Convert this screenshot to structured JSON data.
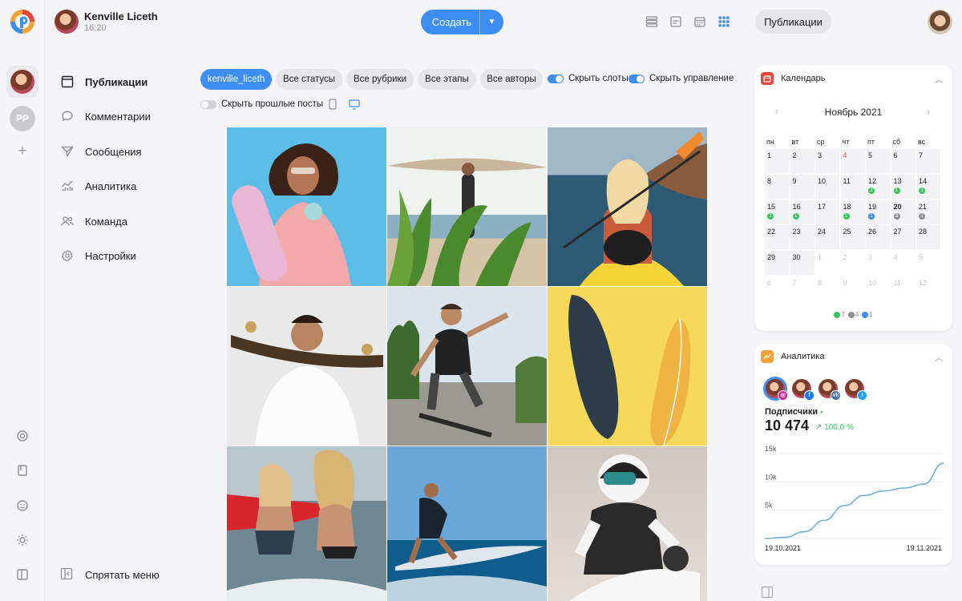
{
  "header": {
    "user_name": "Kenville Liceth",
    "time": "16:20",
    "create_label": "Создать",
    "publications_label": "Публикации",
    "view_icons": [
      "list-view-icon",
      "feed-view-icon",
      "calendar-view-icon",
      "grid-view-icon"
    ]
  },
  "rail": {
    "account_initials": "PP",
    "add_label": "+",
    "bottom_icons": [
      "target-icon",
      "book-icon",
      "smile-icon",
      "sun-icon",
      "panel-icon"
    ]
  },
  "nav": {
    "items": [
      {
        "label": "Публикации",
        "icon": "calendar-page-icon"
      },
      {
        "label": "Комментарии",
        "icon": "chat-bubble-icon"
      },
      {
        "label": "Сообщения",
        "icon": "send-icon"
      },
      {
        "label": "Аналитика",
        "icon": "analytics-icon"
      },
      {
        "label": "Команда",
        "icon": "team-icon"
      },
      {
        "label": "Настройки",
        "icon": "gear-icon"
      }
    ],
    "hide_menu": "Спрятать меню"
  },
  "filters": {
    "chips": [
      "kenville_liceth",
      "Все статусы",
      "Все рубрики",
      "Все этапы",
      "Все авторы"
    ],
    "hide_slots": "Скрыть слоты",
    "hide_control": "Скрыть управление",
    "hide_past": "Скрыть прошлые посты"
  },
  "posts": [
    {
      "subject": "woman-with-skateboard",
      "bg": "#5cbde6"
    },
    {
      "subject": "surfer-with-board",
      "bg": "#cfd8c8"
    },
    {
      "subject": "kayak-woman",
      "bg": "#3e6a86"
    },
    {
      "subject": "man-with-longboard",
      "bg": "#e9e9e9"
    },
    {
      "subject": "skater-jump",
      "bg": "#aab7c0"
    },
    {
      "subject": "surfboards-yellow",
      "bg": "#f6d85a"
    },
    {
      "subject": "beach-couple",
      "bg": "#8aa3ad"
    },
    {
      "subject": "surfer-wave",
      "bg": "#3a7fb1"
    },
    {
      "subject": "motocross-rider",
      "bg": "#d9d4cf"
    }
  ],
  "calendar": {
    "title": "Календарь",
    "month": "Ноябрь 2021",
    "weekdays": [
      "пн",
      "вт",
      "ср",
      "чт",
      "пт",
      "сб",
      "вс"
    ],
    "weeks": [
      [
        {
          "d": "1"
        },
        {
          "d": "2"
        },
        {
          "d": "3"
        },
        {
          "d": "4",
          "red": true
        },
        {
          "d": "5"
        },
        {
          "d": "6"
        },
        {
          "d": "7"
        }
      ],
      [
        {
          "d": "8"
        },
        {
          "d": "9"
        },
        {
          "d": "10"
        },
        {
          "d": "11"
        },
        {
          "d": "12",
          "dot": "green",
          "n": "2"
        },
        {
          "d": "13",
          "dot": "green",
          "n": "1"
        },
        {
          "d": "14",
          "dot": "green",
          "n": "1"
        }
      ],
      [
        {
          "d": "15",
          "dot": "green",
          "n": "1"
        },
        {
          "d": "16",
          "dot": "green",
          "n": "1"
        },
        {
          "d": "17"
        },
        {
          "d": "18",
          "dot": "green",
          "n": "1"
        },
        {
          "d": "19",
          "dot": "blue",
          "n": "1"
        },
        {
          "d": "20",
          "bold": true,
          "dot": "gray",
          "n": "3"
        },
        {
          "d": "21",
          "dot": "gray",
          "n": "1"
        }
      ],
      [
        {
          "d": "22"
        },
        {
          "d": "23"
        },
        {
          "d": "24"
        },
        {
          "d": "25"
        },
        {
          "d": "26"
        },
        {
          "d": "27"
        },
        {
          "d": "28"
        }
      ],
      [
        {
          "d": "29"
        },
        {
          "d": "30"
        },
        {
          "d": "1",
          "empty": true
        },
        {
          "d": "2",
          "empty": true
        },
        {
          "d": "3",
          "empty": true
        },
        {
          "d": "4",
          "empty": true
        },
        {
          "d": "5",
          "empty": true
        }
      ],
      [
        {
          "d": "6",
          "empty": true
        },
        {
          "d": "7",
          "empty": true
        },
        {
          "d": "8",
          "empty": true
        },
        {
          "d": "9",
          "empty": true
        },
        {
          "d": "10",
          "empty": true
        },
        {
          "d": "11",
          "empty": true
        },
        {
          "d": "12",
          "empty": true
        }
      ]
    ],
    "legend": [
      {
        "color": "#34c759",
        "count": "7"
      },
      {
        "color": "#8e8e93",
        "count": "4"
      },
      {
        "color": "#3d8ef0",
        "count": "1"
      }
    ]
  },
  "analytics": {
    "title": "Аналитика",
    "networks": [
      {
        "name": "instagram-badge",
        "color": "#d6249f",
        "glyph": "◎"
      },
      {
        "name": "facebook-badge",
        "color": "#1877f2",
        "glyph": "f"
      },
      {
        "name": "vk-badge",
        "color": "#4c75a3",
        "glyph": "vk"
      },
      {
        "name": "twitter-badge",
        "color": "#1da1f2",
        "glyph": "t"
      }
    ],
    "subs_label": "Подписчики",
    "subs_value": "10 474",
    "growth": "↗ 100,0 %",
    "chart_data": {
      "type": "line",
      "series": [
        {
          "values": [
            0,
            200,
            1200,
            3200,
            5800,
            7600,
            8400,
            8900,
            9600,
            13300
          ]
        }
      ],
      "y_ticks": [
        "15k",
        "10k",
        "5k"
      ],
      "ylim": [
        0,
        15000
      ],
      "x_start": "19.10.2021",
      "x_end": "19.11.2021",
      "color": "#6cb1e0"
    }
  },
  "colors": {
    "accent": "#3d8ef0",
    "green": "#34c759",
    "gray": "#8e8e93"
  }
}
